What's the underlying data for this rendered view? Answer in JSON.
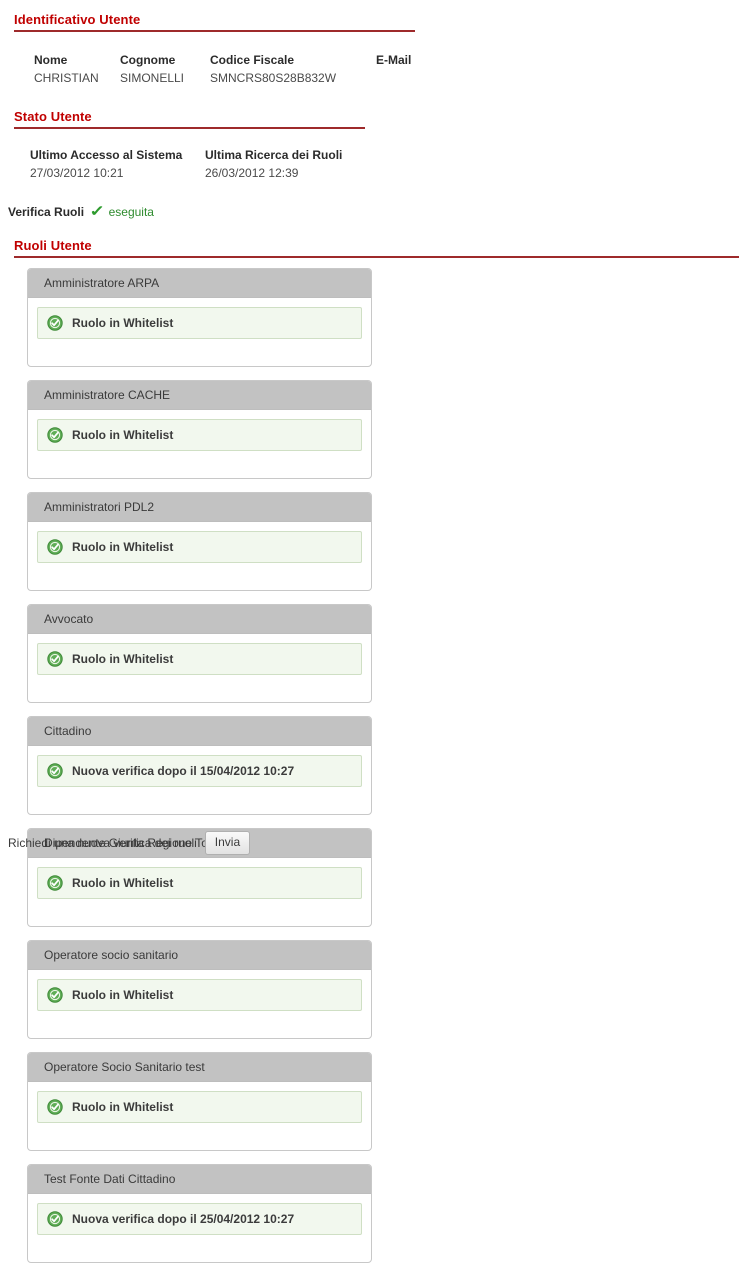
{
  "sections": {
    "identificativo": {
      "title": "Identificativo Utente"
    },
    "stato": {
      "title": "Stato Utente"
    },
    "ruoli": {
      "title": "Ruoli Utente"
    }
  },
  "user": {
    "fields": [
      {
        "label": "Nome",
        "value": "CHRISTIAN"
      },
      {
        "label": "Cognome",
        "value": "SIMONELLI"
      },
      {
        "label": "Codice Fiscale",
        "value": "SMNCRS80S28B832W"
      },
      {
        "label": "E-Mail",
        "value": ""
      }
    ]
  },
  "stato": {
    "fields": [
      {
        "label": "Ultimo Accesso al Sistema",
        "value": "27/03/2012 10:21"
      },
      {
        "label": "Ultima Ricerca dei Ruoli",
        "value": "26/03/2012 12:39"
      }
    ],
    "verifica": {
      "label": "Verifica Ruoli",
      "icon": "check-mark-icon",
      "state": "eseguita"
    }
  },
  "roles": [
    {
      "name": "Amministratore ARPA",
      "status": "Ruolo in Whitelist",
      "icon": "green-check-circle-icon"
    },
    {
      "name": "Amministratore CACHE",
      "status": "Ruolo in Whitelist",
      "icon": "green-check-circle-icon"
    },
    {
      "name": "Amministratori PDL2",
      "status": "Ruolo in Whitelist",
      "icon": "green-check-circle-icon"
    },
    {
      "name": "Avvocato",
      "status": "Ruolo in Whitelist",
      "icon": "green-check-circle-icon"
    },
    {
      "name": "Cittadino",
      "status": "Nuova verifica dopo il 15/04/2012 10:27",
      "icon": "green-check-circle-icon"
    },
    {
      "name": "Dipendente Giunta Regione Toscana",
      "status": "Ruolo in Whitelist",
      "icon": "green-check-circle-icon"
    },
    {
      "name": "Operatore socio sanitario",
      "status": "Ruolo in Whitelist",
      "icon": "green-check-circle-icon"
    },
    {
      "name": "Operatore Socio Sanitario test",
      "status": "Ruolo in Whitelist",
      "icon": "green-check-circle-icon"
    },
    {
      "name": "Test Fonte Dati Cittadino",
      "status": "Nuova verifica dopo il 25/04/2012 10:27",
      "icon": "green-check-circle-icon"
    }
  ],
  "footer": {
    "label": "Richiedi una nuova verifica dei ruoli",
    "button_label": "Invia"
  },
  "colors": {
    "heading_red": "#c00000",
    "rule_red": "#9e2a2b",
    "card_header_gray": "#c2c2c2",
    "status_green_bg": "#f2f8ee",
    "status_green_border": "#cfdfc4",
    "check_green": "#2e9b2e"
  }
}
